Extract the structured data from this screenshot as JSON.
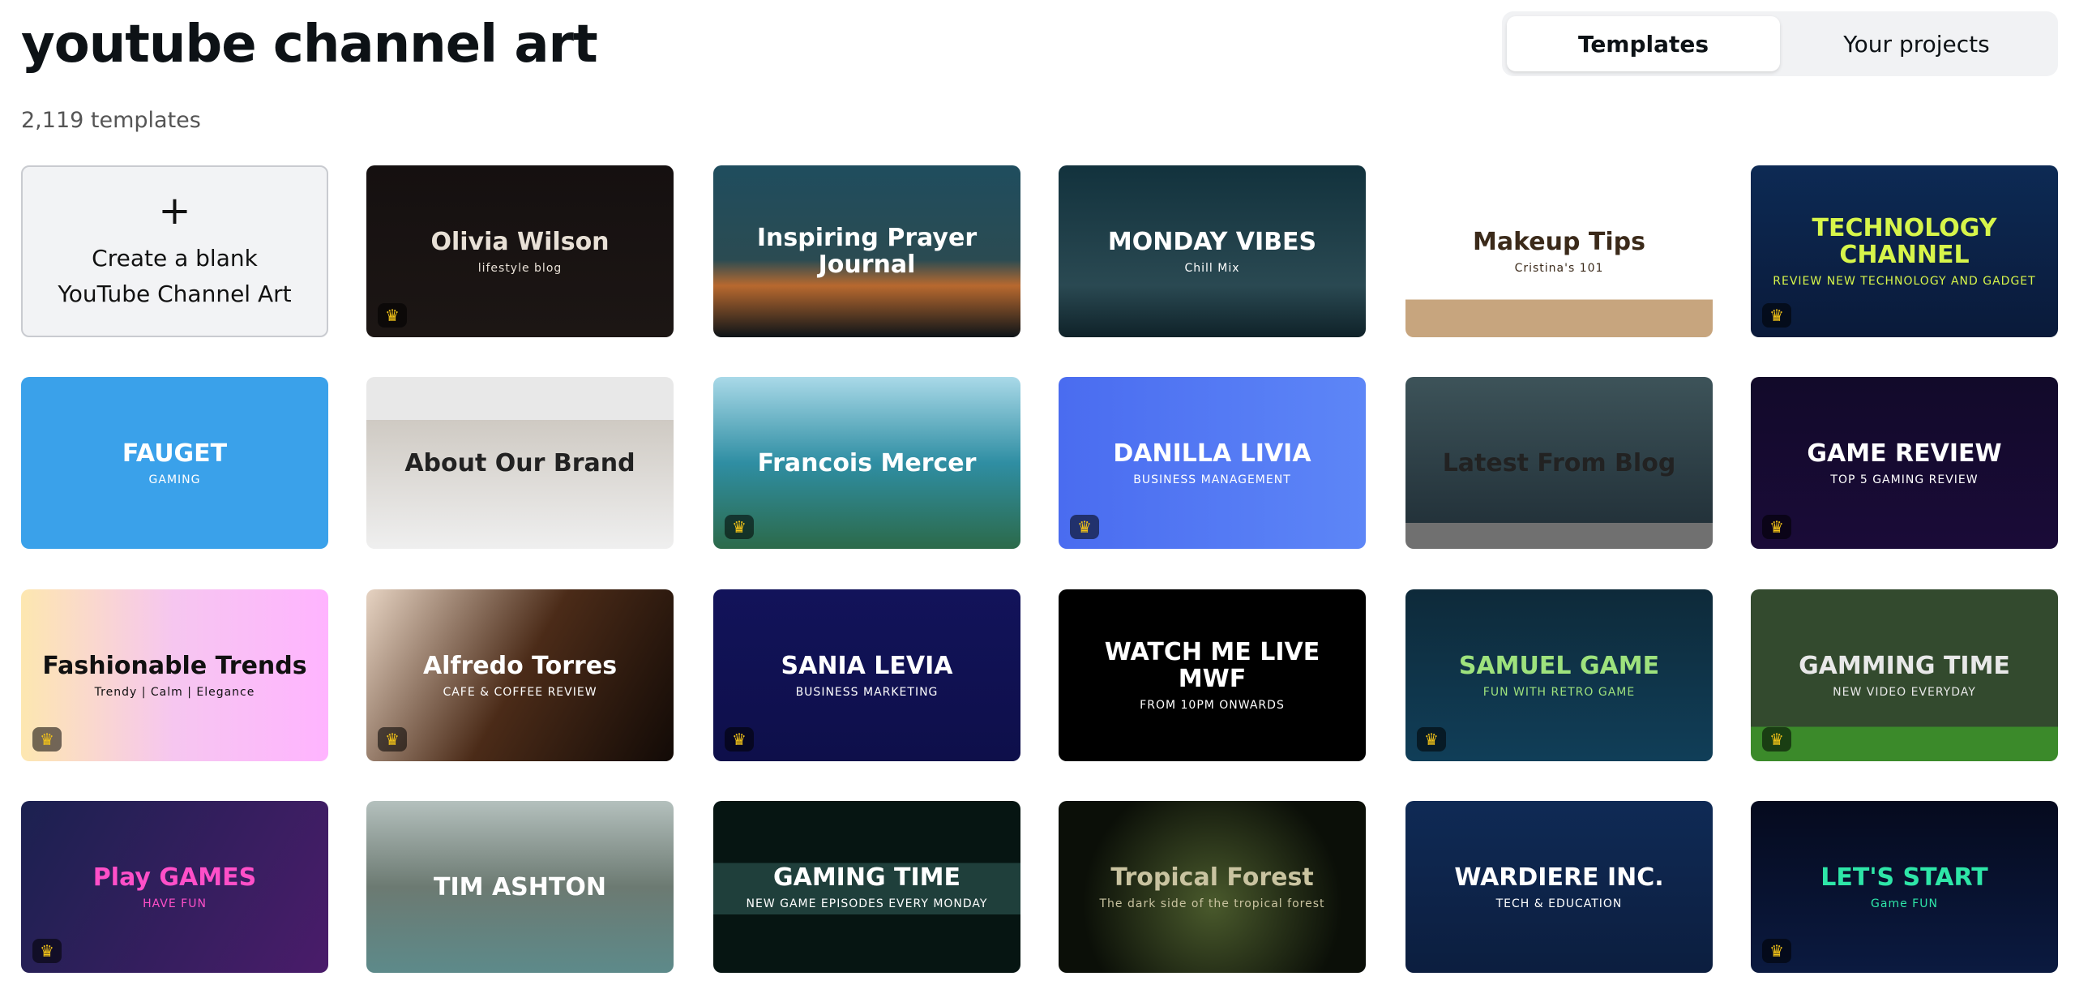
{
  "header": {
    "title": "youtube channel art",
    "count": "2,119 templates"
  },
  "tabs": [
    {
      "label": "Templates",
      "active": true
    },
    {
      "label": "Your projects",
      "active": false
    }
  ],
  "blank": {
    "plus": "+",
    "line1": "Create a blank",
    "line2": "YouTube Channel Art"
  },
  "premium_icon": "crown-icon",
  "cards": [
    {
      "title": "Olivia Wilson",
      "sub": "lifestyle blog",
      "bg": "linear-gradient(#151010,#1c1614)",
      "fg": "#e8e0d6",
      "premium": true
    },
    {
      "title": "Inspiring Prayer Journal",
      "sub": "",
      "bg": "linear-gradient(#1f4d5e,#2b4b52 55%,#b8692f 70%,#0d1418)",
      "fg": "#ffffff",
      "premium": false
    },
    {
      "title": "MONDAY VIBES",
      "sub": "Chill Mix",
      "bg": "linear-gradient(#12323d,#2a4952 70%,#0f2229)",
      "fg": "#ffffff",
      "premium": false
    },
    {
      "title": "Makeup Tips",
      "sub": "Cristina's 101",
      "bg": "linear-gradient(#fff 0 78%,#c7a57e 78%)",
      "fg": "#3b2a1a",
      "premium": false
    },
    {
      "title": "TECHNOLOGY CHANNEL",
      "sub": "REVIEW NEW TECHNOLOGY AND GADGET",
      "bg": "linear-gradient(#0d2a54,#0a1a3a)",
      "fg": "#d7f54a",
      "premium": true
    },
    {
      "title": "FAUGET",
      "sub": "GAMING",
      "bg": "#3aa1ea",
      "fg": "#ffffff",
      "premium": false
    },
    {
      "title": "About Our Brand",
      "sub": "",
      "bg": "linear-gradient(#e8e8e8 0 25%,#cfcac3 25%,#efefef)",
      "fg": "#222",
      "premium": false
    },
    {
      "title": "Francois Mercer",
      "sub": "",
      "bg": "linear-gradient(#a9d9e8,#2f8ea3 50%,#2c6a4a)",
      "fg": "#ffffff",
      "premium": true
    },
    {
      "title": "DANILLA LIVIA",
      "sub": "BUSINESS MANAGEMENT",
      "bg": "linear-gradient(90deg,#4a6cf0,#5d86f7)",
      "fg": "#ffffff",
      "premium": true
    },
    {
      "title": "Latest From Blog",
      "sub": "",
      "bg": "linear-gradient(#3d5359,#23323a 85%,#707070 85%)",
      "fg": "#222",
      "premium": false
    },
    {
      "title": "GAME REVIEW",
      "sub": "TOP 5 GAMING REVIEW",
      "bg": "linear-gradient(#120a2a,#1a0b38)",
      "fg": "#ffffff",
      "premium": true
    },
    {
      "title": "Fashionable Trends",
      "sub": "Trendy | Calm | Elegance",
      "bg": "linear-gradient(90deg,#fde7b0,#f6c6f0,#ffb4ff)",
      "fg": "#111",
      "premium": true
    },
    {
      "title": "Alfredo Torres",
      "sub": "CAFE & COFFEE REVIEW",
      "bg": "linear-gradient(120deg,#e6d3c2,#4b2b18 50%,#120a06)",
      "fg": "#ffffff",
      "premium": true
    },
    {
      "title": "SANIA LEVIA",
      "sub": "BUSINESS MARKETING",
      "bg": "linear-gradient(#12135a,#0e0f4a)",
      "fg": "#ffffff",
      "premium": true
    },
    {
      "title": "WATCH ME LIVE MWF",
      "sub": "FROM 10PM ONWARDS",
      "bg": "#000000",
      "fg": "#ffffff",
      "premium": false
    },
    {
      "title": "SAMUEL GAME",
      "sub": "FUN WITH RETRO GAME",
      "bg": "linear-gradient(#0e2a3a,#103e58)",
      "fg": "#9ee27d",
      "premium": true
    },
    {
      "title": "GAMMING TIME",
      "sub": "NEW VIDEO EVERYDAY",
      "bg": "linear-gradient(#334a2e 0 80%,#3b8a2a 80%)",
      "fg": "#e8e8e8",
      "premium": true
    },
    {
      "title": "Play GAMES",
      "sub": "HAVE FUN",
      "bg": "linear-gradient(120deg,#1b2150,#4a1c6a)",
      "fg": "#ff4fc8",
      "premium": true
    },
    {
      "title": "TIM ASHTON",
      "sub": "",
      "bg": "linear-gradient(#b4c0bd,#6c7a72 50%,#5d8a8a)",
      "fg": "#ffffff",
      "premium": false
    },
    {
      "title": "GAMING TIME",
      "sub": "NEW GAME EPISODES EVERY MONDAY",
      "bg": "linear-gradient(#061512 0 36%,#1f3f3b 36% 66%,#061512 66%)",
      "fg": "#ffffff",
      "premium": false
    },
    {
      "title": "Tropical Forest",
      "sub": "The dark side of the tropical forest",
      "bg": "radial-gradient(circle at 50% 60%,#4a5a2c,#0b0f08 70%)",
      "fg": "#c9c3a0",
      "premium": false
    },
    {
      "title": "WARDIERE INC.",
      "sub": "TECH & EDUCATION",
      "bg": "linear-gradient(#0f2a55,#0c1e3f)",
      "fg": "#ffffff",
      "premium": false
    },
    {
      "title": "LET'S START",
      "sub": "Game  FUN",
      "bg": "linear-gradient(#050a1e,#0b1a40)",
      "fg": "#2ee6a8",
      "premium": true
    }
  ]
}
